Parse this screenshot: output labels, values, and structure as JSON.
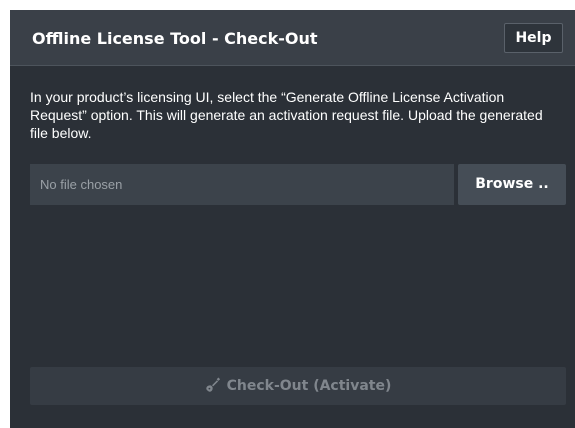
{
  "header": {
    "title": "Offline License Tool - Check-Out",
    "help_label": "Help"
  },
  "instructions": "In your product’s licensing UI, select the “Generate Offline License Activation Request” option. This will generate an activation request file. Upload the generated file below.",
  "file_picker": {
    "placeholder": "No file chosen",
    "browse_label": "Browse .."
  },
  "checkout": {
    "label": "Check-Out (Activate)",
    "icon": "guitar-icon",
    "disabled": true
  },
  "colors": {
    "panel_bg": "#2b3037",
    "header_bg": "#3a4048",
    "input_bg": "#3c434b",
    "button_bg": "#454d56",
    "disabled_text": "#80868d"
  }
}
